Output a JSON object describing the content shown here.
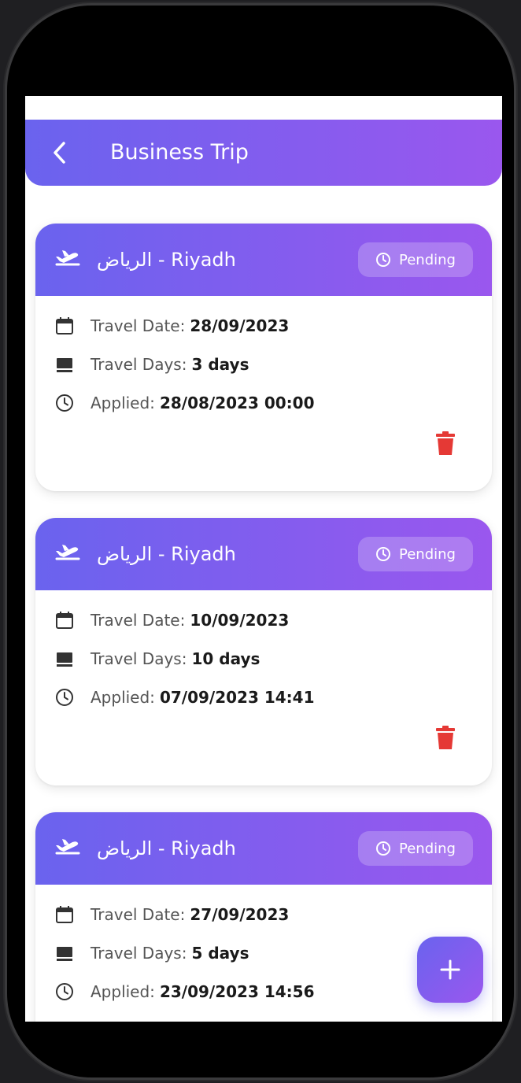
{
  "app_bar": {
    "title": "Business Trip"
  },
  "trips": [
    {
      "destination": "الرياض - Riyadh",
      "status": "Pending",
      "travel_date_label": "Travel Date:",
      "travel_date": "28/09/2023",
      "travel_days_label": "Travel Days:",
      "travel_days": "3 days",
      "applied_label": "Applied:",
      "applied": "28/08/2023 00:00"
    },
    {
      "destination": "الرياض - Riyadh",
      "status": "Pending",
      "travel_date_label": "Travel Date:",
      "travel_date": "10/09/2023",
      "travel_days_label": "Travel Days:",
      "travel_days": "10 days",
      "applied_label": "Applied:",
      "applied": "07/09/2023 14:41"
    },
    {
      "destination": "الرياض - Riyadh",
      "status": "Pending",
      "travel_date_label": "Travel Date:",
      "travel_date": "27/09/2023",
      "travel_days_label": "Travel Days:",
      "travel_days": "5 days",
      "applied_label": "Applied:",
      "applied": "23/09/2023 14:56"
    }
  ],
  "icons": {
    "back": "chevron-left-icon",
    "plane": "flight-takeoff-icon",
    "status": "clock-icon",
    "calendar": "calendar-icon",
    "days": "days-icon",
    "applied": "clock-icon",
    "delete": "trash-icon",
    "fab": "plus-icon"
  },
  "colors": {
    "gradient_start": "#6a63ee",
    "gradient_end": "#9a57ee",
    "delete_red": "#e53935"
  }
}
